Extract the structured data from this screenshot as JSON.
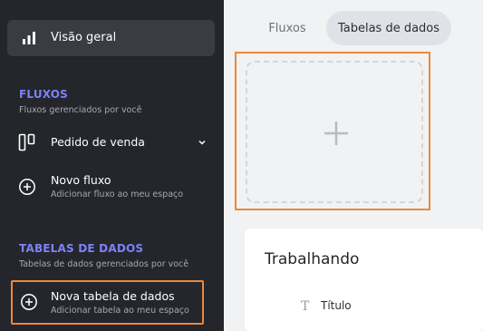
{
  "sidebar": {
    "overview": {
      "label": "Visão geral",
      "icon": "bar-chart-icon"
    },
    "flows_section": {
      "title": "FLUXOS",
      "subtitle": "Fluxos gerenciados por você",
      "items": [
        {
          "label": "Pedido de venda",
          "icon": "kanban-icon"
        },
        {
          "label": "Novo fluxo",
          "sublabel": "Adicionar fluxo ao meu espaço",
          "icon": "plus-circle-icon"
        }
      ]
    },
    "tables_section": {
      "title": "TABELAS DE DADOS",
      "subtitle": "Tabelas de dados gerenciados por você",
      "new_table": {
        "label": "Nova tabela de dados",
        "sublabel": "Adicionar tabela ao meu espaço",
        "icon": "plus-circle-icon"
      }
    }
  },
  "main": {
    "tabs": [
      {
        "label": "Fluxos",
        "active": false
      },
      {
        "label": "Tabelas de dados",
        "active": true
      }
    ],
    "add_card": {
      "icon": "plus-icon"
    },
    "working_card": {
      "title": "Trabalhando",
      "column": {
        "label": "Título",
        "icon": "text-type-icon"
      }
    }
  },
  "colors": {
    "sidebar_bg": "#24262c",
    "accent_purple": "#7b83f7",
    "highlight_orange": "#e98a3b",
    "main_bg": "#f1f2f4"
  }
}
